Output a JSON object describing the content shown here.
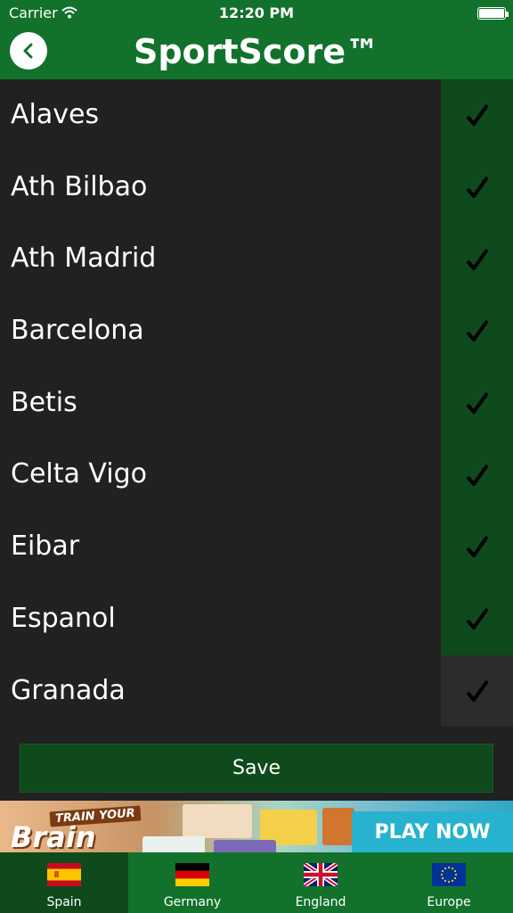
{
  "status_bar": {
    "carrier": "Carrier",
    "time": "12:20 PM"
  },
  "header": {
    "title": "SportScore™"
  },
  "teams": [
    {
      "name": "Alaves",
      "selected": true
    },
    {
      "name": "Ath Bilbao",
      "selected": true
    },
    {
      "name": "Ath Madrid",
      "selected": true
    },
    {
      "name": "Barcelona",
      "selected": true
    },
    {
      "name": "Betis",
      "selected": true
    },
    {
      "name": "Celta Vigo",
      "selected": true
    },
    {
      "name": "Eibar",
      "selected": true
    },
    {
      "name": "Espanol",
      "selected": true
    },
    {
      "name": "Granada",
      "selected": false
    }
  ],
  "save_label": "Save",
  "ad": {
    "brand_small": "TRAIN YOUR",
    "brand_big": "Brain",
    "cta": "PLAY NOW"
  },
  "tabs": [
    {
      "label": "Spain",
      "active": true
    },
    {
      "label": "Germany",
      "active": false
    },
    {
      "label": "England",
      "active": false
    },
    {
      "label": "Europe",
      "active": false
    }
  ],
  "colors": {
    "header_green": "#12722b",
    "selected_green": "#0e4a1c",
    "list_bg": "#212121"
  }
}
